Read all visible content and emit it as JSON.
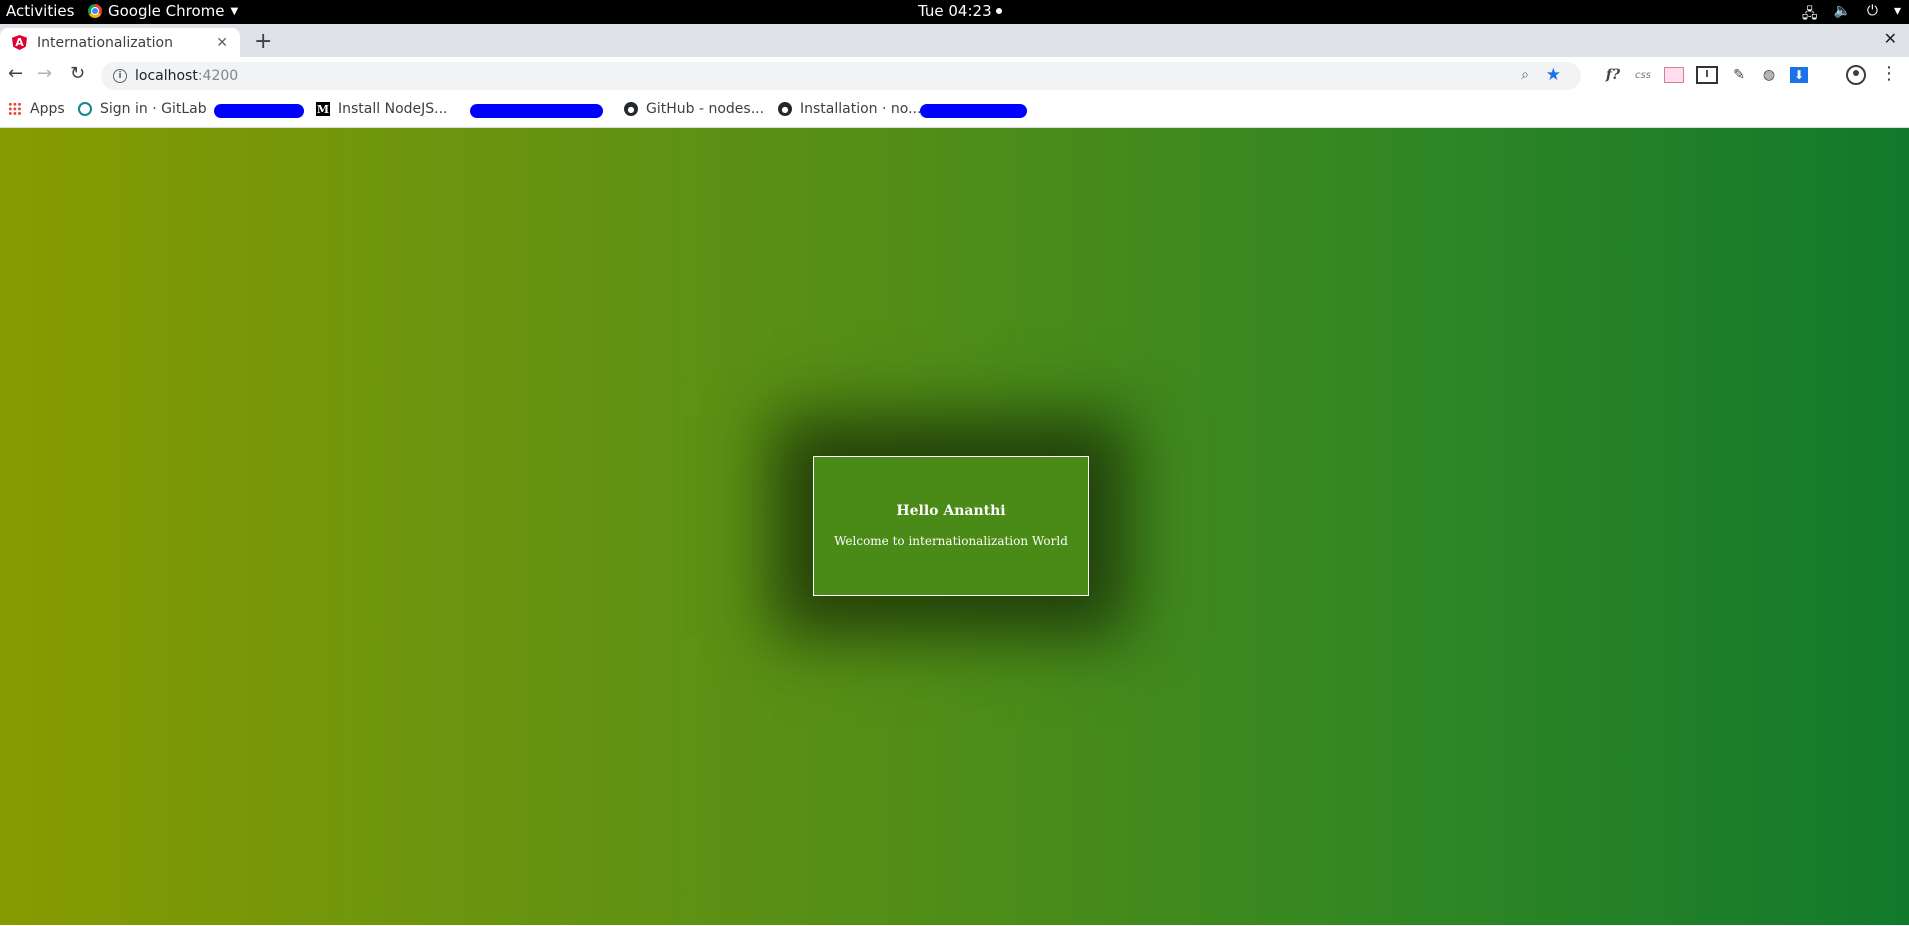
{
  "topbar": {
    "activities": "Activities",
    "app_name": "Google Chrome",
    "clock": "Tue 04:23",
    "tray_icons": [
      "network-icon",
      "volume-icon",
      "power-icon",
      "chevron-down-icon"
    ]
  },
  "tab": {
    "title": "Internationalization",
    "close": "✕",
    "new_tab": "+",
    "window_close": "✕"
  },
  "toolbar": {
    "back": "←",
    "forward": "→",
    "reload": "↻",
    "url_host": "localhost",
    "url_port": ":4200",
    "zoom": "⌕",
    "star": "★",
    "ext_f": "f?",
    "ext_css": "css",
    "ext_box": "I",
    "ext_pen": "✎",
    "ext_globe": "◍",
    "ext_download": "⬇",
    "menu": "⋮"
  },
  "bookmarks": [
    {
      "label": "Apps",
      "icon": "apps-grid-icon"
    },
    {
      "label": "Sign in · GitLab",
      "icon": "gitlab-icon"
    },
    {
      "label": "Install NodeJS...",
      "icon": "medium-icon"
    },
    {
      "label": "GitHub - nodes...",
      "icon": "github-icon"
    },
    {
      "label": "Installation · no...",
      "icon": "github-icon"
    }
  ],
  "page": {
    "heading": "Hello Ananthi",
    "message": "Welcome to internationalization World"
  },
  "colors": {
    "gradient_start": "#879b00",
    "gradient_end": "#12792c",
    "card_bg": "#4a8a17",
    "redaction": "#0000ff"
  }
}
